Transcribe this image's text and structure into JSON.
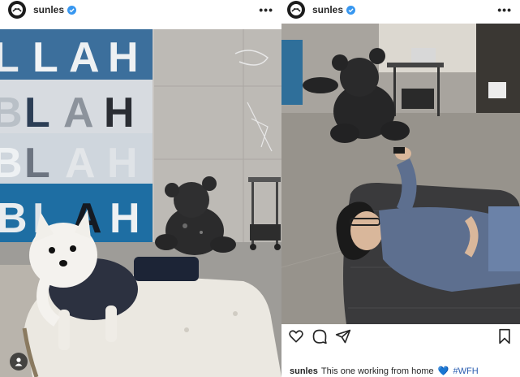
{
  "left_post": {
    "username": "sunles",
    "verified": true,
    "more_label": "•••",
    "photo_art_letters": [
      "B",
      "L",
      "A",
      "H"
    ]
  },
  "right_post": {
    "username": "sunles",
    "verified": true,
    "more_label": "•••",
    "caption": {
      "username": "sunles",
      "text": "This one working from home",
      "emoji": "💙",
      "hashtag": "#WFH"
    }
  },
  "icons": [
    "heart-icon",
    "comment-icon",
    "share-icon",
    "bookmark-icon",
    "user-tag-icon",
    "more-icon",
    "verified-badge-icon"
  ],
  "colors": {
    "verified": "#3897f0",
    "hashtag": "#2a5db0",
    "text": "#262626"
  }
}
